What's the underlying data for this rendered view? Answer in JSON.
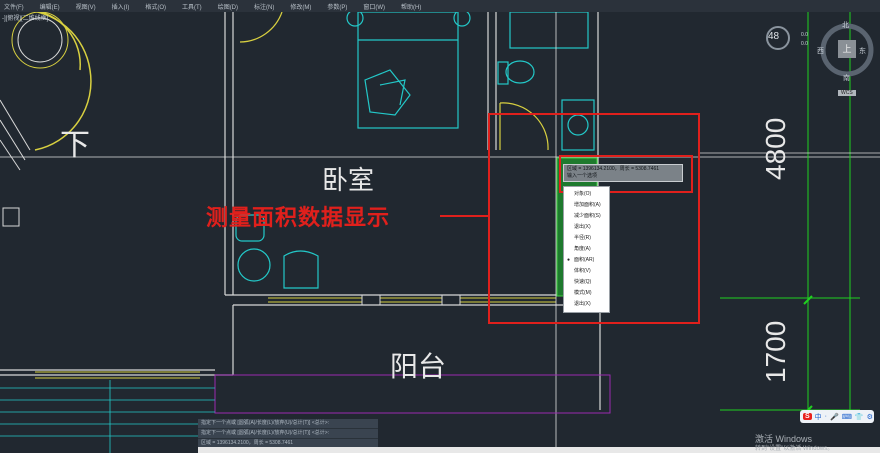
{
  "menubar": {
    "items": [
      "文件(F)",
      "编辑(E)",
      "视图(V)",
      "插入(I)",
      "格式(O)",
      "工具(T)",
      "绘图(D)",
      "标注(N)",
      "修改(M)",
      "参数(P)",
      "窗口(W)",
      "帮助(H)"
    ]
  },
  "viewport": {
    "label": "-][俯视][二维线框]"
  },
  "rooms": {
    "bedroom": "卧室",
    "balcony": "阳台",
    "stair_down": "下"
  },
  "dimensions": {
    "top": "4800",
    "bottom": "1700"
  },
  "annotation": {
    "text": "测量面积数据显示"
  },
  "tooltip": {
    "line1": "区域 = 1396134.2100，周长 = 5308.7461",
    "line2": "输入一个选项"
  },
  "context_menu": {
    "items": [
      "对象(O)",
      "增加面积(A)",
      "减少面积(S)",
      "退出(X)",
      "半径(R)",
      "角度(A)",
      "面积(AR)",
      "体积(V)",
      "快速(Q)",
      "模式(M)",
      "退出(X)"
    ],
    "selected_index": 6
  },
  "command": {
    "lines": [
      "指定下一个点或 [圆弧(A)/长度(L)/放弃(U)/总计(T)] <总计>:",
      "指定下一个点或 [圆弧(A)/长度(L)/放弃(U)/总计(T)] <总计>:",
      "区域 = 1396134.2100，周长 = 5308.7461"
    ]
  },
  "viewcube": {
    "north": "北",
    "south": "南",
    "east": "东",
    "west": "西",
    "top": "上",
    "wcs": "WCS"
  },
  "zoom": {
    "value": "48"
  },
  "coords": {
    "line1": "0.0",
    "line2": "0.0"
  },
  "ime": {
    "logo": "S",
    "mode": "中",
    "items": [
      "·",
      "🎤",
      "⌨",
      "👕",
      "⚙"
    ]
  },
  "watermark": {
    "line1": "激活 Windows",
    "line2": "转到\"设置\"以激活 Windows。"
  },
  "colors": {
    "background": "#212830",
    "wall": "#d8d8d8",
    "furniture": "#23c8c8",
    "door": "#d8d040",
    "annotation_red": "#e0201c",
    "dimension_green": "#20d020",
    "selection_fill": "#1e7a2e"
  }
}
